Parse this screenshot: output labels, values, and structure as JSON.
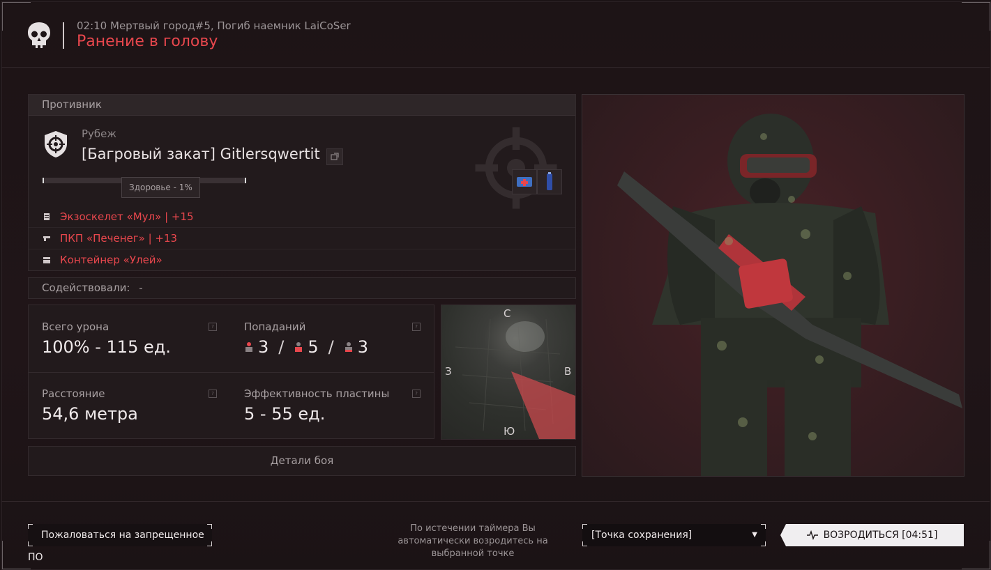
{
  "header": {
    "subtitle": "02:10 Мертвый город#5, Погиб наемник LaiCoSer",
    "title": "Ранение в голову"
  },
  "enemy_panel": {
    "heading": "Противник",
    "rank": "Рубеж",
    "name": "[Багровый закат] Gitlersqwertit",
    "health_tooltip": "Здоровье - 1%",
    "health_fraction": 0.01,
    "loadout": [
      {
        "icon": "armor-icon",
        "label": "Экзоскелет «Мул» | +15"
      },
      {
        "icon": "gun-icon",
        "label": "ПКП «Печенег» | +13"
      },
      {
        "icon": "container-icon",
        "label": "Контейнер «Улей»"
      }
    ],
    "items": [
      "medkit-icon",
      "battery-icon"
    ]
  },
  "assist": {
    "label": "Содействовали:",
    "value": "-"
  },
  "stats": {
    "damage": {
      "label": "Всего урона",
      "value": "100% - 115 ед."
    },
    "hits": {
      "label": "Попаданий",
      "values": [
        "3",
        "5",
        "3"
      ],
      "slash": "/"
    },
    "distance": {
      "label": "Расстояние",
      "value": "54,6 метра"
    },
    "plate": {
      "label": "Эффективность пластины",
      "value": "5 - 55 ед."
    },
    "help_glyph": "?"
  },
  "minimap": {
    "n": "С",
    "s": "Ю",
    "w": "З",
    "e": "В"
  },
  "details_button": "Детали боя",
  "footer": {
    "report_button": "Пожаловаться на запрещенное ПО",
    "timer_note": "По истечении таймера Вы автоматически возродитесь на выбранной точке",
    "spawn_select": "[Точка сохранения]",
    "respawn_button": "ВОЗРОДИТЬСЯ [04:51]"
  },
  "colors": {
    "accent": "#e8474d",
    "panel": "#221a1c",
    "background": "#1b1315"
  }
}
